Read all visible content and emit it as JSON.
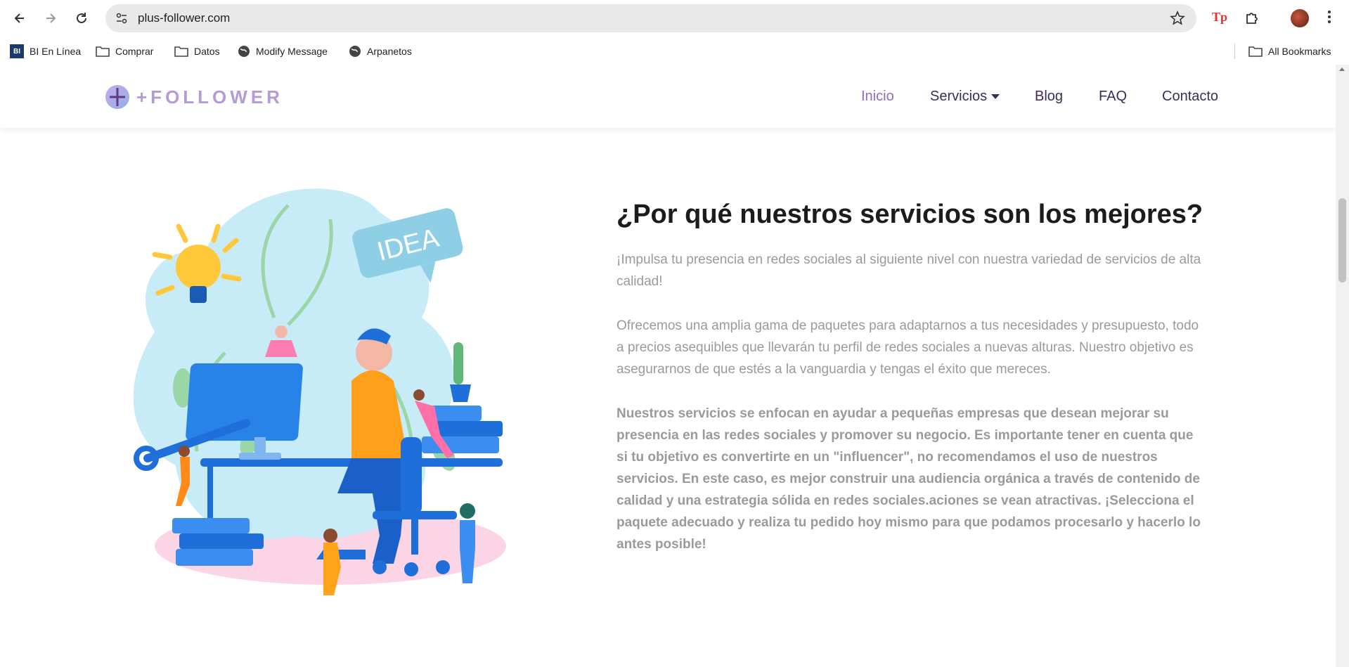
{
  "browser": {
    "url": "plus-follower.com",
    "bookmarks": [
      "BI En Línea",
      "Comprar",
      "Datos",
      "Modify Message",
      "Arpanetos"
    ],
    "all_bookmarks": "All Bookmarks",
    "bi_badge": "BI",
    "ext_badge": "Tp"
  },
  "site": {
    "logo": "+FOLLOWER",
    "nav": {
      "inicio": "Inicio",
      "servicios": "Servicios",
      "blog": "Blog",
      "faq": "FAQ",
      "contacto": "Contacto"
    }
  },
  "content": {
    "heading": "¿Por qué nuestros servicios son los mejores?",
    "p1": "¡Impulsa tu presencia en redes sociales al siguiente nivel con nuestra variedad de servicios de alta calidad!",
    "p2": "Ofrecemos una amplia gama de paquetes para adaptarnos a tus necesidades y presupuesto, todo a precios asequibles que llevarán tu perfil de redes sociales a nuevas alturas. Nuestro objetivo es asegurarnos de que estés a la vanguardia y tengas el éxito que mereces.",
    "p3": "Nuestros servicios se enfocan en ayudar a pequeñas empresas que desean mejorar su presencia en las redes sociales y promover su negocio. Es importante tener en cuenta que si tu objetivo es convertirte en un \"influencer\", no recomendamos el uso de nuestros servicios. En este caso, es mejor construir una audiencia orgánica a través de contenido de calidad y una estrategia sólida en redes sociales.aciones se vean atractivas. ¡Selecciona el paquete adecuado y realiza tu pedido hoy mismo para que podamos procesarlo y hacerlo lo antes posible!",
    "illustration_label": "IDEA"
  },
  "colors": {
    "accent": "#8e6cc4",
    "nav_text": "#3a2e57",
    "body_text": "#9a9a9a"
  }
}
